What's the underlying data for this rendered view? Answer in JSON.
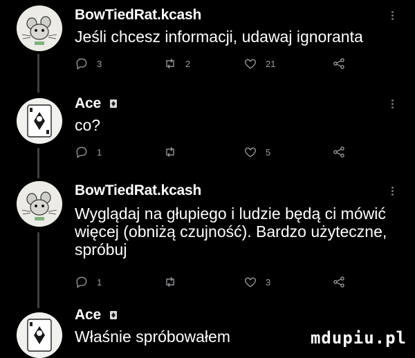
{
  "tweets": [
    {
      "author": "BowTiedRat.kcash",
      "text": "Jeśli chcesz informacji, udawaj ignoranta",
      "replies": "3",
      "retweets": "2",
      "likes": "21",
      "avatar": "rat-avatar"
    },
    {
      "author": "Ace",
      "text": "co?",
      "replies": "1",
      "retweets": "",
      "likes": "5",
      "avatar": "card-avatar"
    },
    {
      "author": "BowTiedRat.kcash",
      "text": "Wyglądaj na głupiego i ludzie będą ci mówić więcej (obniżą czujność). Bardzo użyteczne, spróbuj",
      "replies": "1",
      "retweets": "",
      "likes": "3",
      "avatar": "rat-avatar"
    },
    {
      "author": "Ace",
      "text": "Właśnie spróbowałem",
      "avatar": "card-avatar"
    }
  ],
  "watermark": "mdupiu.pl",
  "colors": {
    "background": "#000000",
    "text": "#ffffff",
    "muted": "#9aa0a6",
    "thread_line": "#3d4044"
  }
}
